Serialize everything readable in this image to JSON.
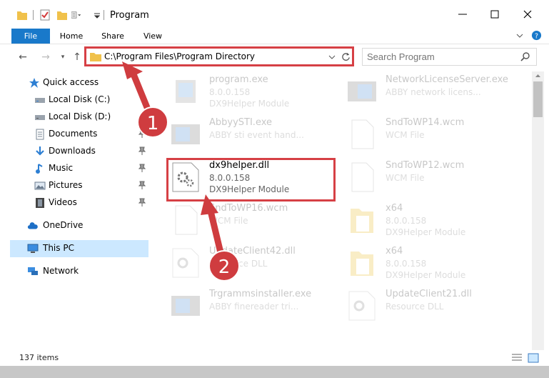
{
  "window": {
    "title": "Program",
    "controls": [
      "minimize-icon",
      "maximize-icon",
      "close-icon"
    ]
  },
  "ribbon": {
    "tabs": [
      {
        "label": "File"
      },
      {
        "label": "Home"
      },
      {
        "label": "Share"
      },
      {
        "label": "View"
      }
    ]
  },
  "address_bar": {
    "path": "C:\\Program Files\\Program Directory"
  },
  "search": {
    "placeholder": "Search Program"
  },
  "sidebar": {
    "items": [
      {
        "label": "Quick access",
        "icon": "star-icon"
      },
      {
        "label": "Local Disk (C:)",
        "icon": "drive-icon"
      },
      {
        "label": "Local Disk (D:)",
        "icon": "drive-icon"
      },
      {
        "label": "Documents",
        "icon": "documents-icon",
        "pinned": true
      },
      {
        "label": "Downloads",
        "icon": "download-icon",
        "pinned": true
      },
      {
        "label": "Music",
        "icon": "music-icon",
        "pinned": true
      },
      {
        "label": "Pictures",
        "icon": "pictures-icon",
        "pinned": true
      },
      {
        "label": "Videos",
        "icon": "videos-icon",
        "pinned": true
      },
      {
        "label": "OneDrive",
        "icon": "cloud-icon"
      },
      {
        "label": "This PC",
        "icon": "computer-icon",
        "selected": true
      },
      {
        "label": "Network",
        "icon": "network-icon"
      }
    ]
  },
  "files": [
    {
      "name": "program.exe",
      "line2": "8.0.0.158",
      "line3": "DX9Helper Module",
      "icon": "exe-icon"
    },
    {
      "name": "NetworkLicenseServer.exe",
      "line2": "ABBY network licens...",
      "line3": "",
      "icon": "exe-icon"
    },
    {
      "name": "AbbyySTI.exe",
      "line2": "ABBY sti event hand...",
      "line3": "",
      "icon": "exe-icon"
    },
    {
      "name": "SndToWP14.wcm",
      "line2": "WCM File",
      "line3": "",
      "icon": "file-icon"
    },
    {
      "name": "dx9helper.dll",
      "line2": "8.0.0.158",
      "line3": "DX9Helper Module",
      "icon": "dll-icon"
    },
    {
      "name": "SndToWP12.wcm",
      "line2": "WCM File",
      "line3": "",
      "icon": "file-icon"
    },
    {
      "name": "SndToWP16.wcm",
      "line2": "WCM File",
      "line3": "",
      "icon": "file-icon"
    },
    {
      "name": "x64",
      "line2": "8.0.0.158",
      "line3": "DX9Helper Module",
      "icon": "folder-dll-icon"
    },
    {
      "name": "UpdateClient42.dll",
      "line2": "Resource DLL",
      "line3": "",
      "icon": "dll-icon"
    },
    {
      "name": "x64",
      "line2": "8.0.0.158",
      "line3": "DX9Helper Module",
      "icon": "folder-dll-icon"
    },
    {
      "name": "Trgrammsinstaller.exe",
      "line2": "ABBY finereader tri...",
      "line3": "",
      "icon": "exe-icon"
    },
    {
      "name": "UpdateClient21.dll",
      "line2": "Resource DLL",
      "line3": "",
      "icon": "dll-icon"
    }
  ],
  "status": {
    "item_count": "137 items"
  },
  "annotations": {
    "step1": "1",
    "step2": "2",
    "accent": "#d64045"
  }
}
